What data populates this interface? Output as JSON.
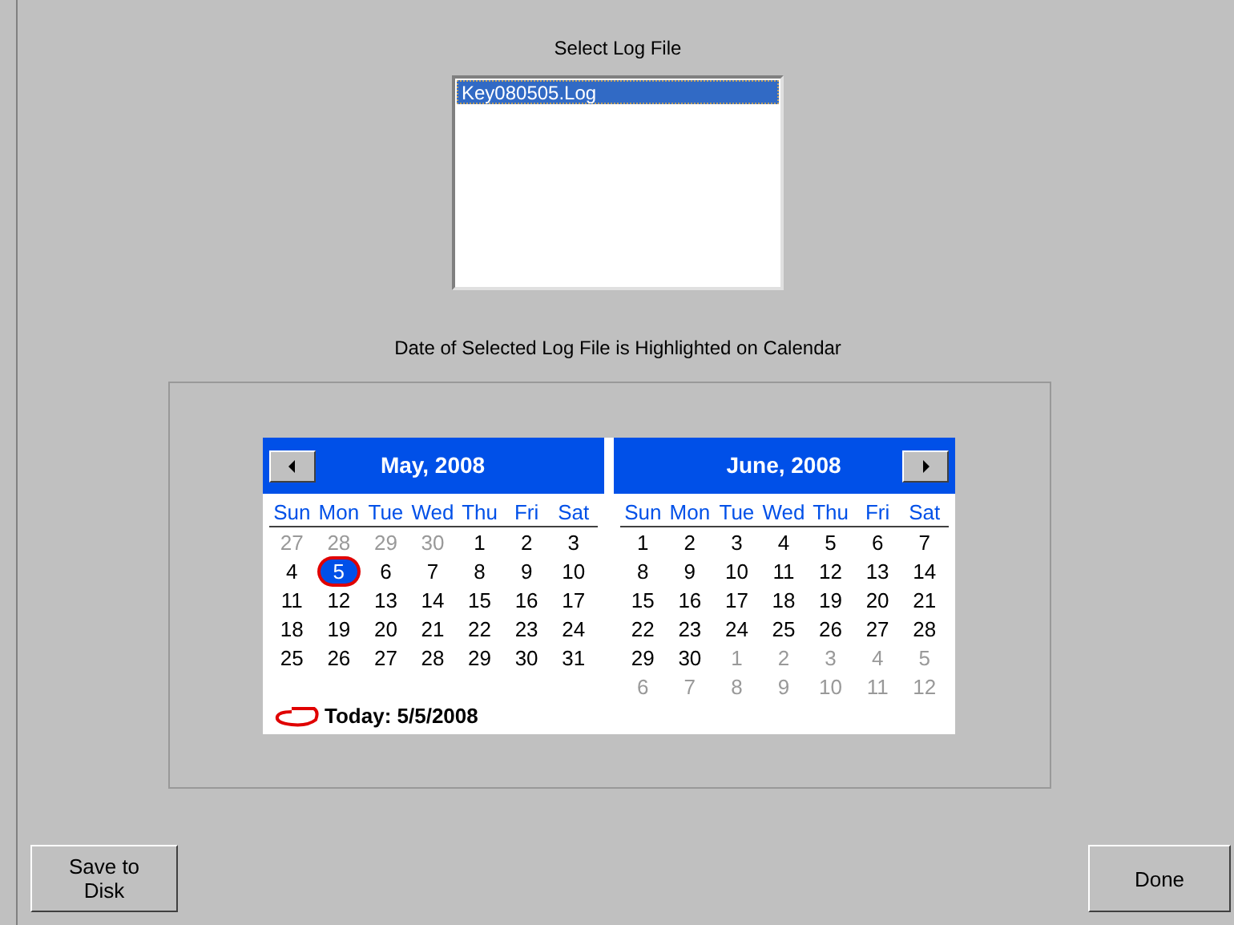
{
  "file_list": {
    "title": "Select Log File",
    "items": [
      {
        "label": "Key080505.Log",
        "selected": true
      }
    ]
  },
  "calendar_caption": "Date of Selected Log File is Highlighted on Calendar",
  "calendar": {
    "months": [
      {
        "title": "May, 2008",
        "kind": "prev",
        "day_names": [
          "Sun",
          "Mon",
          "Tue",
          "Wed",
          "Thu",
          "Fri",
          "Sat"
        ],
        "weeks": [
          [
            {
              "text": "27",
              "muted": true,
              "selected": false
            },
            {
              "text": "28",
              "muted": true,
              "selected": false
            },
            {
              "text": "29",
              "muted": true,
              "selected": false
            },
            {
              "text": "30",
              "muted": true,
              "selected": false
            },
            {
              "text": "1",
              "muted": false,
              "selected": false
            },
            {
              "text": "2",
              "muted": false,
              "selected": false
            },
            {
              "text": "3",
              "muted": false,
              "selected": false
            }
          ],
          [
            {
              "text": "4",
              "muted": false,
              "selected": false
            },
            {
              "text": "5",
              "muted": false,
              "selected": true
            },
            {
              "text": "6",
              "muted": false,
              "selected": false
            },
            {
              "text": "7",
              "muted": false,
              "selected": false
            },
            {
              "text": "8",
              "muted": false,
              "selected": false
            },
            {
              "text": "9",
              "muted": false,
              "selected": false
            },
            {
              "text": "10",
              "muted": false,
              "selected": false
            }
          ],
          [
            {
              "text": "11",
              "muted": false,
              "selected": false
            },
            {
              "text": "12",
              "muted": false,
              "selected": false
            },
            {
              "text": "13",
              "muted": false,
              "selected": false
            },
            {
              "text": "14",
              "muted": false,
              "selected": false
            },
            {
              "text": "15",
              "muted": false,
              "selected": false
            },
            {
              "text": "16",
              "muted": false,
              "selected": false
            },
            {
              "text": "17",
              "muted": false,
              "selected": false
            }
          ],
          [
            {
              "text": "18",
              "muted": false,
              "selected": false
            },
            {
              "text": "19",
              "muted": false,
              "selected": false
            },
            {
              "text": "20",
              "muted": false,
              "selected": false
            },
            {
              "text": "21",
              "muted": false,
              "selected": false
            },
            {
              "text": "22",
              "muted": false,
              "selected": false
            },
            {
              "text": "23",
              "muted": false,
              "selected": false
            },
            {
              "text": "24",
              "muted": false,
              "selected": false
            }
          ],
          [
            {
              "text": "25",
              "muted": false,
              "selected": false
            },
            {
              "text": "26",
              "muted": false,
              "selected": false
            },
            {
              "text": "27",
              "muted": false,
              "selected": false
            },
            {
              "text": "28",
              "muted": false,
              "selected": false
            },
            {
              "text": "29",
              "muted": false,
              "selected": false
            },
            {
              "text": "30",
              "muted": false,
              "selected": false
            },
            {
              "text": "31",
              "muted": false,
              "selected": false
            }
          ]
        ]
      },
      {
        "title": "June, 2008",
        "kind": "next",
        "day_names": [
          "Sun",
          "Mon",
          "Tue",
          "Wed",
          "Thu",
          "Fri",
          "Sat"
        ],
        "weeks": [
          [
            {
              "text": "1",
              "muted": false,
              "selected": false
            },
            {
              "text": "2",
              "muted": false,
              "selected": false
            },
            {
              "text": "3",
              "muted": false,
              "selected": false
            },
            {
              "text": "4",
              "muted": false,
              "selected": false
            },
            {
              "text": "5",
              "muted": false,
              "selected": false
            },
            {
              "text": "6",
              "muted": false,
              "selected": false
            },
            {
              "text": "7",
              "muted": false,
              "selected": false
            }
          ],
          [
            {
              "text": "8",
              "muted": false,
              "selected": false
            },
            {
              "text": "9",
              "muted": false,
              "selected": false
            },
            {
              "text": "10",
              "muted": false,
              "selected": false
            },
            {
              "text": "11",
              "muted": false,
              "selected": false
            },
            {
              "text": "12",
              "muted": false,
              "selected": false
            },
            {
              "text": "13",
              "muted": false,
              "selected": false
            },
            {
              "text": "14",
              "muted": false,
              "selected": false
            }
          ],
          [
            {
              "text": "15",
              "muted": false,
              "selected": false
            },
            {
              "text": "16",
              "muted": false,
              "selected": false
            },
            {
              "text": "17",
              "muted": false,
              "selected": false
            },
            {
              "text": "18",
              "muted": false,
              "selected": false
            },
            {
              "text": "19",
              "muted": false,
              "selected": false
            },
            {
              "text": "20",
              "muted": false,
              "selected": false
            },
            {
              "text": "21",
              "muted": false,
              "selected": false
            }
          ],
          [
            {
              "text": "22",
              "muted": false,
              "selected": false
            },
            {
              "text": "23",
              "muted": false,
              "selected": false
            },
            {
              "text": "24",
              "muted": false,
              "selected": false
            },
            {
              "text": "25",
              "muted": false,
              "selected": false
            },
            {
              "text": "26",
              "muted": false,
              "selected": false
            },
            {
              "text": "27",
              "muted": false,
              "selected": false
            },
            {
              "text": "28",
              "muted": false,
              "selected": false
            }
          ],
          [
            {
              "text": "29",
              "muted": false,
              "selected": false
            },
            {
              "text": "30",
              "muted": false,
              "selected": false
            },
            {
              "text": "1",
              "muted": true,
              "selected": false
            },
            {
              "text": "2",
              "muted": true,
              "selected": false
            },
            {
              "text": "3",
              "muted": true,
              "selected": false
            },
            {
              "text": "4",
              "muted": true,
              "selected": false
            },
            {
              "text": "5",
              "muted": true,
              "selected": false
            }
          ],
          [
            {
              "text": "6",
              "muted": true,
              "selected": false
            },
            {
              "text": "7",
              "muted": true,
              "selected": false
            },
            {
              "text": "8",
              "muted": true,
              "selected": false
            },
            {
              "text": "9",
              "muted": true,
              "selected": false
            },
            {
              "text": "10",
              "muted": true,
              "selected": false
            },
            {
              "text": "11",
              "muted": true,
              "selected": false
            },
            {
              "text": "12",
              "muted": true,
              "selected": false
            }
          ]
        ]
      }
    ],
    "today": "Today: 5/5/2008"
  },
  "buttons": [
    {
      "label": "Save to Disk",
      "kind": "left"
    },
    {
      "label": "Done",
      "kind": "right"
    }
  ]
}
